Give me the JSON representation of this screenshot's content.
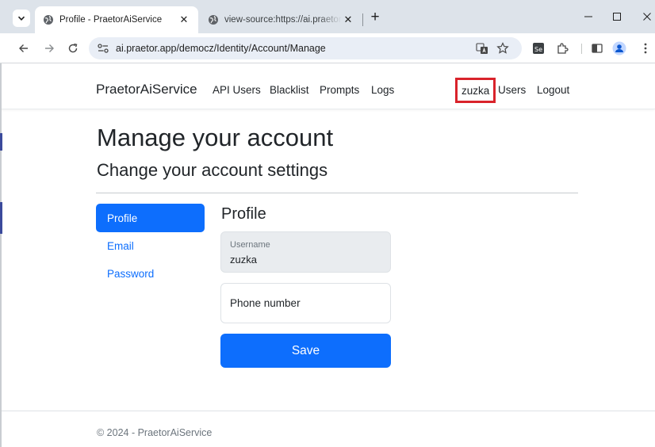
{
  "browser": {
    "tabs": [
      {
        "title": "Profile - PraetorAiService",
        "active": true
      },
      {
        "title": "view-source:https://ai.praetor.ai",
        "active": false
      }
    ],
    "new_tab": "+",
    "close_glyph": "✕",
    "url": "ai.praetor.app/democz/Identity/Account/Manage",
    "icons": [
      "tab-search-icon",
      "globe-icon",
      "back-icon",
      "forward-icon",
      "reload-icon",
      "site-info-icon",
      "translate-icon",
      "bookmark-star-icon",
      "selenium-extension-icon",
      "extensions-icon",
      "side-panel-icon",
      "profile-icon",
      "menu-dots-icon",
      "minimize-icon",
      "maximize-icon",
      "close-window-icon"
    ]
  },
  "navbar": {
    "brand": "PraetorAiService",
    "links": [
      "API Users",
      "Blacklist",
      "Prompts",
      "Logs"
    ],
    "user": "zuzka",
    "right_links": [
      "Users",
      "Logout"
    ],
    "highlight_color": "#d9232b"
  },
  "page": {
    "title": "Manage your account",
    "subtitle": "Change your account settings"
  },
  "sidebar": {
    "items": [
      {
        "label": "Profile",
        "active": true
      },
      {
        "label": "Email",
        "active": false
      },
      {
        "label": "Password",
        "active": false
      }
    ],
    "accent": "#0d6efd"
  },
  "profile": {
    "heading": "Profile",
    "username_label": "Username",
    "username_value": "zuzka",
    "phone_placeholder": "Phone number",
    "phone_value": "",
    "save_label": "Save"
  },
  "footer": {
    "text": "© 2024 - PraetorAiService"
  }
}
